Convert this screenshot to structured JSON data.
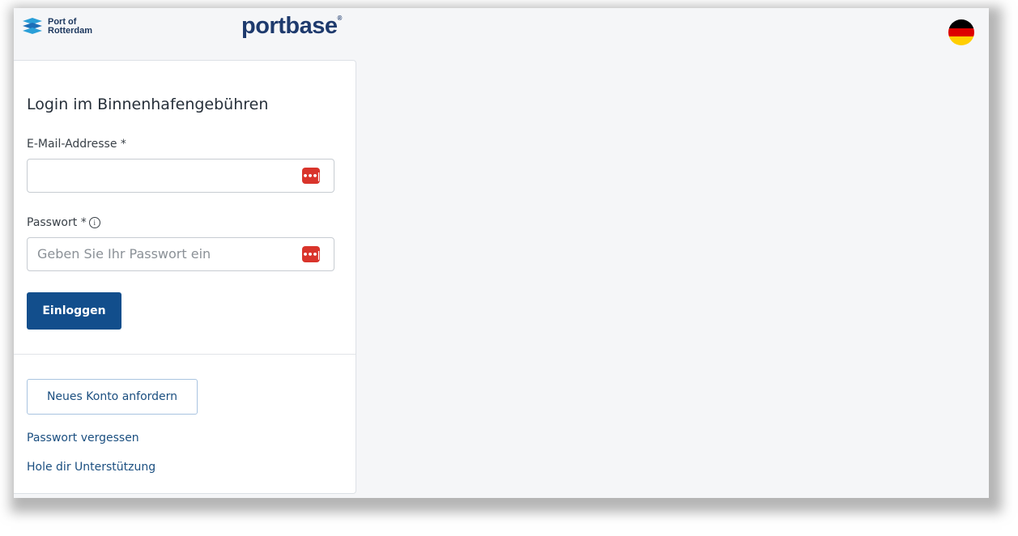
{
  "header": {
    "por_logo_line1": "Port of",
    "por_logo_line2": "Rotterdam",
    "portbase_logo": "portbase",
    "language_flag": "german-flag-icon"
  },
  "login": {
    "title": "Login im Binnenhafengebühren",
    "email_label": "E-Mail-Addresse *",
    "email_value": "",
    "password_label": "Passwort *",
    "password_placeholder": "Geben Sie Ihr Passwort ein",
    "password_value": "",
    "submit_label": "Einloggen"
  },
  "footer": {
    "request_account_label": "Neues Konto anfordern",
    "forgot_password_link": "Passwort vergessen",
    "support_link": "Hole dir Unterstützung"
  },
  "colors": {
    "primary": "#124e8c",
    "link": "#1b4f80",
    "password_manager_icon": "#d9342b",
    "background": "#f5f6f8"
  }
}
